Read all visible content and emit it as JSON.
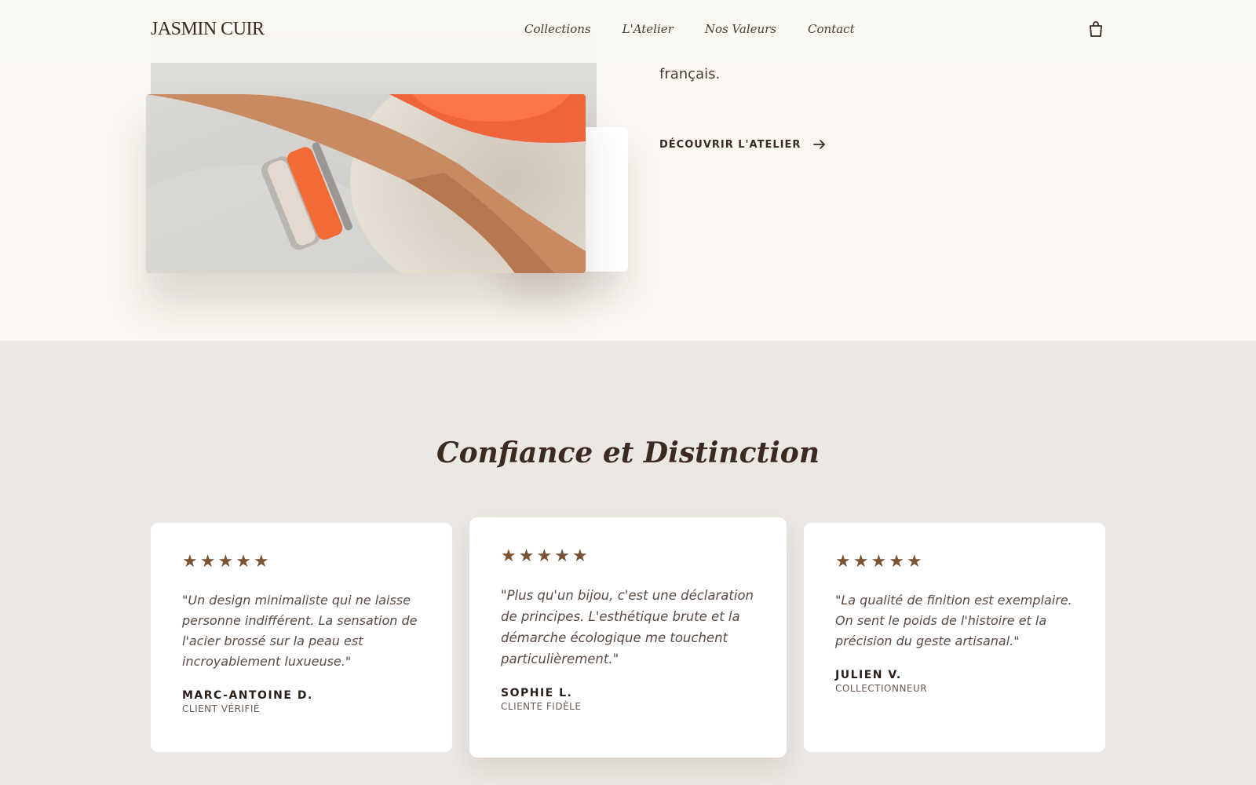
{
  "brand": {
    "logo": "JASMIN CUIR"
  },
  "nav": {
    "items": [
      "Collections",
      "L'Atelier",
      "Nos Valeurs",
      "Contact"
    ]
  },
  "icons": {
    "cart": "shopping-bag-icon",
    "arrow": "arrow-right-icon",
    "star": "star-icon"
  },
  "hero": {
    "text_tail": "français.",
    "cta": "DÉCOUVRIR L'ATELIER"
  },
  "testimonials": {
    "title": "Confiance et Distinction",
    "rating_max": 5,
    "items": [
      {
        "rating": 5,
        "quote": "\"Un design minimaliste qui ne laisse personne indifférent. La sensation de l'acier brossé sur la peau est incroyablement luxueuse.\"",
        "author": "MARC-ANTOINE D.",
        "role": "CLIENT VÉRIFIÉ"
      },
      {
        "rating": 5,
        "quote": "\"Plus qu'un bijou, c'est une déclaration de principes. L'esthétique brute et la démarche écologique me touchent particulièrement.\"",
        "author": "SOPHIE L.",
        "role": "CLIENTE FIDÈLE"
      },
      {
        "rating": 5,
        "quote": "\"La qualité de finition est exemplaire. On sent le poids de l'histoire et la précision du geste artisanal.\"",
        "author": "JULIEN V.",
        "role": "COLLECTIONNEUR"
      }
    ]
  },
  "colors": {
    "accent": "#7b5232",
    "background": "#faf7f2",
    "section_bg": "#ebe7e2",
    "text": "#3a2a22"
  }
}
